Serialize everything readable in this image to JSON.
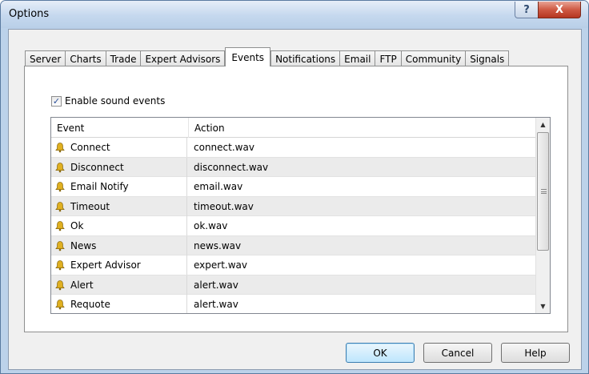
{
  "window": {
    "title": "Options",
    "help_glyph": "?",
    "close_glyph": "X"
  },
  "tabs": [
    {
      "label": "Server",
      "active": false
    },
    {
      "label": "Charts",
      "active": false
    },
    {
      "label": "Trade",
      "active": false
    },
    {
      "label": "Expert Advisors",
      "active": false
    },
    {
      "label": "Events",
      "active": true
    },
    {
      "label": "Notifications",
      "active": false
    },
    {
      "label": "Email",
      "active": false
    },
    {
      "label": "FTP",
      "active": false
    },
    {
      "label": "Community",
      "active": false
    },
    {
      "label": "Signals",
      "active": false
    }
  ],
  "events_tab": {
    "enable_sound": {
      "label": "Enable sound events",
      "checked": true,
      "check_glyph": "✓"
    },
    "columns": {
      "event": "Event",
      "action": "Action"
    },
    "rows": [
      {
        "event": "Connect",
        "action": "connect.wav",
        "icon": "bell-icon"
      },
      {
        "event": "Disconnect",
        "action": "disconnect.wav",
        "icon": "bell-icon"
      },
      {
        "event": "Email Notify",
        "action": "email.wav",
        "icon": "bell-icon"
      },
      {
        "event": "Timeout",
        "action": "timeout.wav",
        "icon": "bell-icon"
      },
      {
        "event": "Ok",
        "action": "ok.wav",
        "icon": "bell-icon"
      },
      {
        "event": "News",
        "action": "news.wav",
        "icon": "bell-icon"
      },
      {
        "event": "Expert Advisor",
        "action": "expert.wav",
        "icon": "bell-icon"
      },
      {
        "event": "Alert",
        "action": "alert.wav",
        "icon": "bell-icon"
      },
      {
        "event": "Requote",
        "action": "alert.wav",
        "icon": "bell-icon"
      }
    ],
    "scroll_up_glyph": "▲",
    "scroll_down_glyph": "▼"
  },
  "buttons": {
    "ok": "OK",
    "cancel": "Cancel",
    "help": "Help"
  },
  "colors": {
    "titlebar": "#c5d8ee",
    "close_button": "#cf5a44",
    "bell": "#e0b020",
    "default_button": "#bee6fd"
  }
}
